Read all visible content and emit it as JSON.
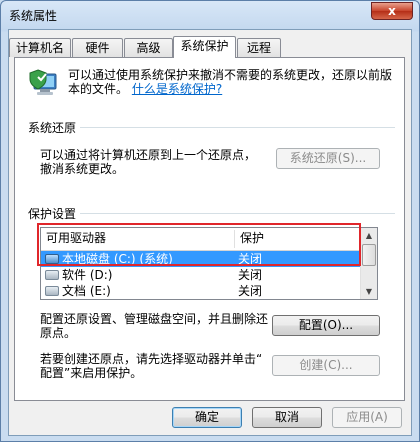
{
  "window": {
    "title": "系统属性",
    "close_label": "x"
  },
  "tabs": [
    {
      "label": "计算机名"
    },
    {
      "label": "硬件"
    },
    {
      "label": "高级"
    },
    {
      "label": "系统保护"
    },
    {
      "label": "远程"
    }
  ],
  "intro": {
    "line1": "可以通过使用系统保护来撤消不需要的系统更改，还原以前版",
    "line2": "本的文件。",
    "link": "什么是系统保护?"
  },
  "restore": {
    "group_label": "系统还原",
    "desc_line1": "可以通过将计算机还原到上一个还原点，",
    "desc_line2": "撤消系统更改。",
    "button": "系统还原(S)..."
  },
  "protection": {
    "group_label": "保护设置",
    "columns": {
      "drive": "可用驱动器",
      "protection": "保护"
    },
    "rows": [
      {
        "name": "本地磁盘 (C:) (系统)",
        "protection": "关闭"
      },
      {
        "name": "软件 (D:)",
        "protection": "关闭"
      },
      {
        "name": "文档 (E:)",
        "protection": "关闭"
      }
    ],
    "config_desc_line1": "配置还原设置、管理磁盘空间，并且删除还",
    "config_desc_line2": "原点。",
    "config_button": "配置(O)...",
    "create_desc_line1": "若要创建还原点，请先选择驱动器并单击“",
    "create_desc_line2": "配置”来启用保护。",
    "create_button": "创建(C)..."
  },
  "footer": {
    "ok": "确定",
    "cancel": "取消",
    "apply": "应用(A)"
  }
}
